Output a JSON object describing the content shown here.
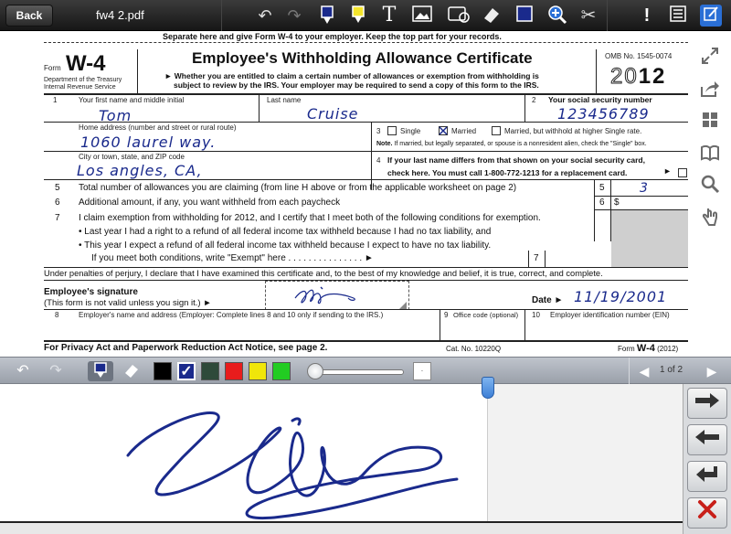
{
  "toolbar": {
    "back_label": "Back",
    "document_name": "fw4 2.pdf",
    "icons": [
      "undo-icon",
      "redo-icon",
      "pen-icon",
      "highlighter-icon",
      "text-icon",
      "image-icon",
      "shape-icon",
      "eraser-icon",
      "color-icon",
      "zoom-icon",
      "scissors-icon",
      "attention-icon",
      "page-list-icon",
      "sign-icon"
    ]
  },
  "sidebar_icons": [
    "expand-icon",
    "share-icon",
    "thumbnails-icon",
    "book-icon",
    "search-icon",
    "hand-icon"
  ],
  "form": {
    "separator_text": "Separate here and give Form W-4 to your employer. Keep the top part for your records.",
    "form_label": "Form",
    "form_number": "W-4",
    "dept_line1": "Department of the Treasury",
    "dept_line2": "Internal Revenue Service",
    "title": "Employee's Withholding Allowance Certificate",
    "subtitle_line1": "Whether you are entitled to claim a certain number of allowances or exemption from withholding is",
    "subtitle_line2": "subject to review by the IRS. Your employer may be required to send a copy of this form to the IRS.",
    "omb": "OMB No. 1545-0074",
    "year_light": "20",
    "year_bold": "12",
    "field1_num": "1",
    "field1_label": "Your first name and middle initial",
    "first_name": "Tom",
    "lastname_label": "Last name",
    "last_name": "Cruise",
    "field2_num": "2",
    "ssn_label": "Your social security number",
    "ssn": "123456789",
    "address_label": "Home address (number and street or rural route)",
    "address": "1060 laurel way.",
    "field3_num": "3",
    "single_label": "Single",
    "married_label": "Married",
    "married_higher_label": "Married, but withhold at higher Single rate.",
    "note_bold": "Note.",
    "note_text": "If married, but legally separated, or spouse is a nonresident alien, check the \"Single\" box.",
    "city_label": "City or town, state, and ZIP code",
    "city": "Los angles, CA,",
    "field4_num": "4",
    "line4_text1": "If your last name differs from that shown on your social security card,",
    "line4_text2": "check here. You must call 1-800-772-1213 for a replacement card.",
    "line5_num": "5",
    "line5_text": "Total number of allowances you are claiming (from line H above or from the applicable worksheet on page 2)",
    "line5_value": "3",
    "line6_num": "6",
    "line6_text": "Additional amount, if any, you want withheld from each paycheck",
    "line6_dollar": "$",
    "line7_num": "7",
    "line7_text": "I claim exemption from withholding for 2012, and I certify that I meet both of the following conditions for exemption.",
    "line7_bullet1": "• Last year I had a right to a refund of all federal income tax withheld because I had no tax liability, and",
    "line7_bullet2": "• This year I expect a refund of all federal income tax withheld because I expect to have no tax liability.",
    "line7_exempt": "If you meet both conditions, write \"Exempt\" here . . . . . . . . . . . . . . . ►",
    "line7_box": "7",
    "perjury": "Under penalties of perjury, I declare that I have examined this certificate and, to the best of my knowledge and belief, it is true, correct, and complete.",
    "sig_label": "Employee's signature",
    "sig_sub": "(This form is not valid unless you sign it.) ►",
    "date_label": "Date ►",
    "date_value": "11/19/2001",
    "line8_num": "8",
    "line8_text": "Employer's name and address (Employer: Complete lines 8 and 10 only if sending to the IRS.)",
    "line9_num": "9",
    "line9_text": "Office code (optional)",
    "line10_num": "10",
    "line10_text": "Employer identification number (EIN)",
    "privacy": "For Privacy Act and Paperwork Reduction Act Notice, see page 2.",
    "cat_no": "Cat. No. 10220Q",
    "footer_form": "Form",
    "footer_w4": "W-4",
    "footer_year": "(2012)"
  },
  "signature_bar": {
    "colors": [
      "#000000",
      "#1a2a8c",
      "#2e4a3a",
      "#e81c1c",
      "#f0e60a",
      "#22cc22"
    ],
    "selected_color": "#1a2a8c",
    "page_indicator": "1 of 2"
  },
  "right_panel": {
    "buttons": [
      "next-arrow-icon",
      "prev-arrow-icon",
      "return-icon",
      "close-icon"
    ]
  }
}
